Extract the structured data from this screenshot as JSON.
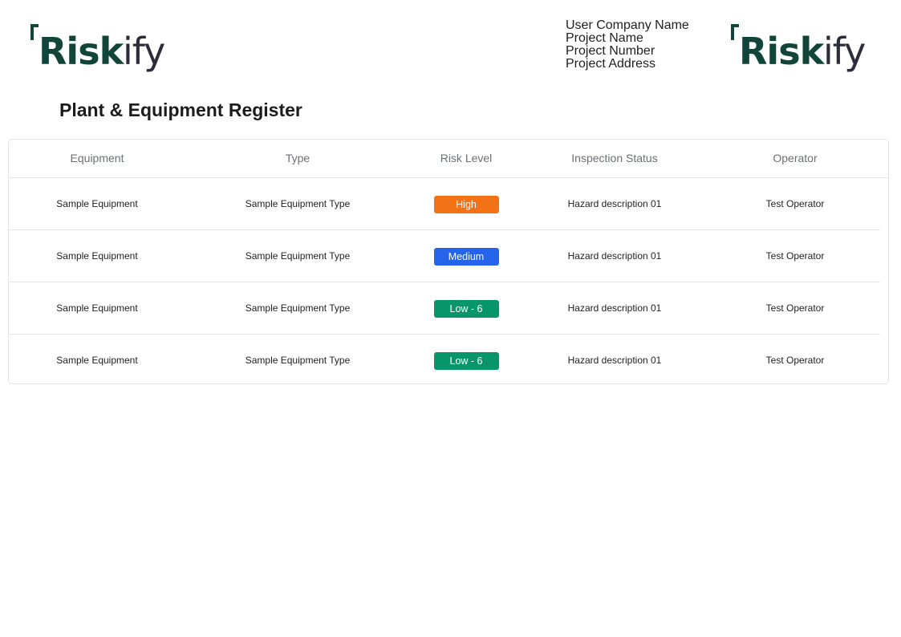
{
  "brand": {
    "name": "Riskify",
    "logo_text_color": "#11453a",
    "logo_suffix_color": "#2c2c3a"
  },
  "project": {
    "company": "User Company Name",
    "name": "Project Name",
    "number": "Project Number",
    "address": "Project Address"
  },
  "page_title": "Plant & Equipment Register",
  "table": {
    "headers": {
      "equipment": "Equipment",
      "type": "Type",
      "risk_level": "Risk Level",
      "inspection_status": "Inspection Status",
      "operator": "Operator"
    },
    "rows": [
      {
        "equipment": "Sample Equipment",
        "type": "Sample Equipment Type",
        "risk": "High",
        "risk_color": "#f47216",
        "inspection": "Hazard description 01",
        "operator": "Test Operator"
      },
      {
        "equipment": "Sample Equipment",
        "type": "Sample Equipment Type",
        "risk": "Medium",
        "risk_color": "#2563eb",
        "inspection": "Hazard description 01",
        "operator": "Test Operator"
      },
      {
        "equipment": "Sample Equipment",
        "type": "Sample Equipment Type",
        "risk": "Low - 6",
        "risk_color": "#069669",
        "inspection": "Hazard description 01",
        "operator": "Test Operator"
      },
      {
        "equipment": "Sample Equipment",
        "type": "Sample Equipment Type",
        "risk": "Low - 6",
        "risk_color": "#069669",
        "inspection": "Hazard description 01",
        "operator": "Test Operator"
      }
    ]
  }
}
